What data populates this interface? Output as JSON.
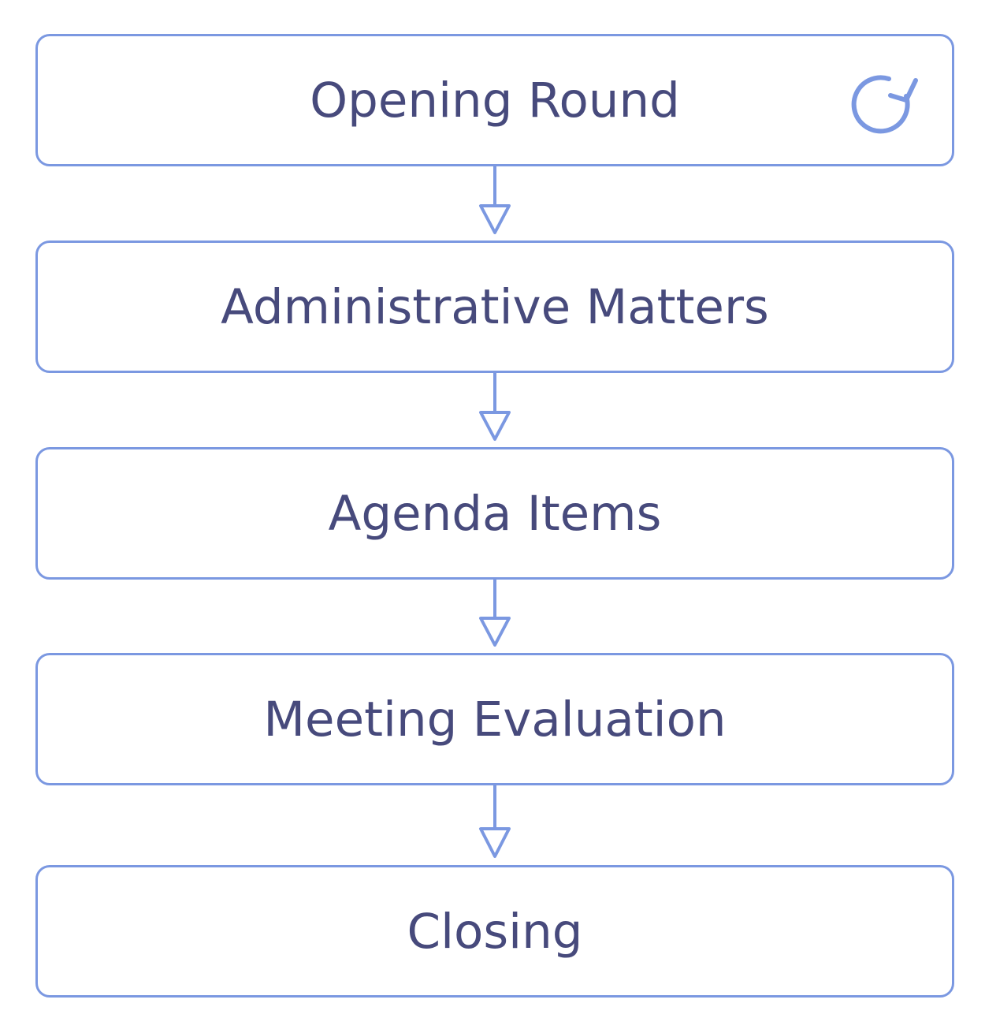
{
  "colors": {
    "border": "#7b98e1",
    "text": "#474a7c",
    "background": "#ffffff"
  },
  "steps": [
    {
      "label": "Opening Round",
      "icon": "repeat-icon"
    },
    {
      "label": "Administrative Matters"
    },
    {
      "label": "Agenda Items"
    },
    {
      "label": "Meeting Evaluation"
    },
    {
      "label": "Closing"
    }
  ]
}
